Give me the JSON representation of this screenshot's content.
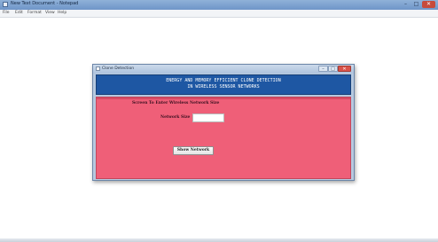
{
  "notepad": {
    "title": "New Text Document - Notepad",
    "menu": [
      "File",
      "Edit",
      "Format",
      "View",
      "Help"
    ],
    "controls": {
      "minimize": "–",
      "maximize": "□",
      "close": "✕"
    }
  },
  "dialog": {
    "title": "Clone Detection",
    "controls": {
      "minimize": "–",
      "maximize": "□",
      "close": "✕"
    },
    "header_line1": "ENERGY AND MEMORY EFFICIENT CLONE DETECTION",
    "header_line2": "IN WIRELESS SENSOR NETWORKS",
    "instruction": "Screen To Enter Wireless Network Size",
    "network_size_label": "Network Size",
    "network_size_value": "",
    "show_button_label": "Show Network"
  },
  "colors": {
    "header_bg": "#1e57a3",
    "body_bg": "#ef5f78",
    "titlebar_bg": "#6e95c8"
  }
}
